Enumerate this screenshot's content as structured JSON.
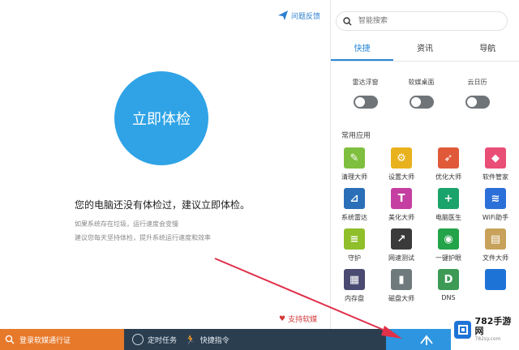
{
  "main": {
    "feedback_label": "问题反馈",
    "checkup_button": "立即体检",
    "headline": "您的电脑还没有体检过，建议立即体检。",
    "tip1": "如果系统存在垃圾，运行速度会变慢",
    "tip2": "建议您每天坚持体检，提升系统运行速度和效率",
    "support_label": "支持软媒"
  },
  "panel": {
    "search_placeholder": "智能搜索",
    "tabs": [
      {
        "label": "快捷",
        "active": true
      },
      {
        "label": "资讯",
        "active": false
      },
      {
        "label": "导航",
        "active": false
      }
    ],
    "toggles": [
      {
        "label": "雷达浮窗",
        "on": false
      },
      {
        "label": "软媒桌面",
        "on": false
      },
      {
        "label": "云日历",
        "on": false
      }
    ],
    "section_title": "常用应用",
    "apps": [
      {
        "label": "清理大师",
        "color": "#7fbf3f",
        "glyph": "✎",
        "icon": "broom-icon"
      },
      {
        "label": "设置大师",
        "color": "#e8b21e",
        "glyph": "⚙",
        "icon": "gear-icon"
      },
      {
        "label": "优化大师",
        "color": "#e05a3a",
        "glyph": "➶",
        "icon": "rocket-icon"
      },
      {
        "label": "软件管家",
        "color": "#e94e77",
        "glyph": "◆",
        "icon": "colorful-cube-icon"
      },
      {
        "label": "系统雷达",
        "color": "#2a6fb8",
        "glyph": "⊿",
        "icon": "radar-icon"
      },
      {
        "label": "美化大师",
        "color": "#c43fa1",
        "glyph": "T",
        "icon": "tshirt-icon"
      },
      {
        "label": "电脑医生",
        "color": "#1aa36a",
        "glyph": "+",
        "icon": "medical-kit-icon"
      },
      {
        "label": "WiFi助手",
        "color": "#2b6fd8",
        "glyph": "≋",
        "icon": "wifi-icon"
      },
      {
        "label": "守护",
        "color": "#8fbf2a",
        "glyph": "≡",
        "icon": "shield-icon"
      },
      {
        "label": "网速测试",
        "color": "#3a3a3a",
        "glyph": "↗",
        "icon": "speedometer-icon"
      },
      {
        "label": "一键护眼",
        "color": "#23a34a",
        "glyph": "◉",
        "icon": "eye-icon"
      },
      {
        "label": "文件大师",
        "color": "#c8a25a",
        "glyph": "▤",
        "icon": "folder-icon"
      },
      {
        "label": "内存盘",
        "color": "#4a4a72",
        "glyph": "▦",
        "icon": "memory-chip-icon"
      },
      {
        "label": "磁盘大师",
        "color": "#6f7a7c",
        "glyph": "▮",
        "icon": "disk-icon"
      },
      {
        "label": "DNS",
        "color": "#3c9a55",
        "glyph": "D",
        "icon": "dns-icon"
      },
      {
        "label": "",
        "color": "#1e74d6",
        "glyph": "",
        "icon": "blank-icon"
      }
    ]
  },
  "bottom": {
    "login_text": "登录软媒通行证",
    "item1": "定时任务",
    "item2": "快捷指令"
  },
  "watermark": {
    "title": "782手游网",
    "sub": "782sy.com"
  }
}
